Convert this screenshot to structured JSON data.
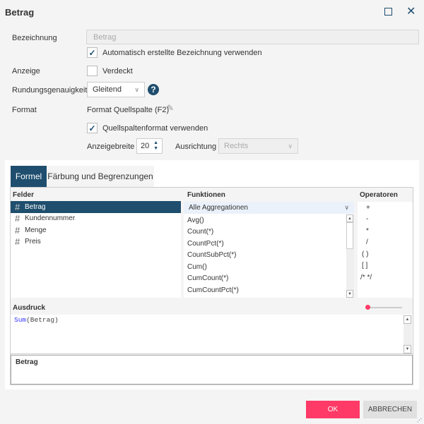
{
  "dialog": {
    "title": "Betrag",
    "maximize_icon": "maximize-icon",
    "close_icon": "close-icon"
  },
  "form": {
    "bezeichnung_label": "Bezeichnung",
    "bezeichnung_placeholder": "Betrag",
    "auto_label": "Automatisch erstellte Bezeichnung verwenden",
    "auto_checked": true,
    "anzeige_label": "Anzeige",
    "verdeckt_label": "Verdeckt",
    "verdeckt_checked": false,
    "rundung_label": "Rundungsgenauigkeit",
    "rundung_value": "Gleitend",
    "format_label": "Format",
    "format_value": "Format Quellspalte (F2)",
    "quell_label": "Quellspaltenformat verwenden",
    "quell_checked": true,
    "anzeigebreite_label": "Anzeigebreite",
    "anzeigebreite_value": "20",
    "ausrichtung_label": "Ausrichtung",
    "ausrichtung_value": "Rechts"
  },
  "tabs": [
    {
      "label": "Formel",
      "active": true
    },
    {
      "label": "Färbung und Begrenzungen",
      "active": false
    }
  ],
  "felder": {
    "header": "Felder",
    "items": [
      "Betrag",
      "Kundennummer",
      "Menge",
      "Preis"
    ],
    "selected": "Betrag"
  },
  "funktionen": {
    "header": "Funktionen",
    "filter": "Alle Aggregationen",
    "items": [
      "Avg()",
      "Count(*)",
      "CountPct(*)",
      "CountSubPct(*)",
      "Cum()",
      "CumCount(*)",
      "CumCountPct(*)"
    ]
  },
  "operatoren": {
    "header": "Operatoren",
    "items": [
      "+",
      "-",
      "*",
      "/",
      "( )",
      "[ ]",
      "/* */"
    ]
  },
  "ausdruck": {
    "label": "Ausdruck",
    "func": "Sum",
    "args": "(Betrag)",
    "preview": "Betrag"
  },
  "buttons": {
    "ok": "OK",
    "cancel": "ABBRECHEN"
  },
  "colors": {
    "accent": "#ff3a66",
    "primary": "#1f4e6e"
  }
}
